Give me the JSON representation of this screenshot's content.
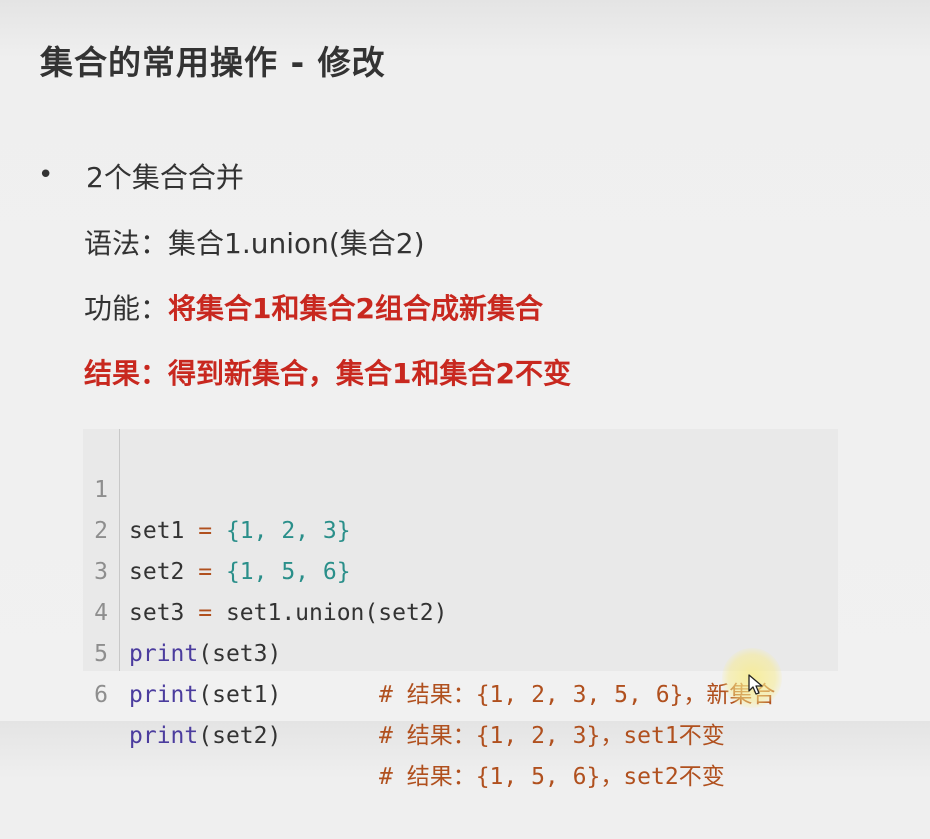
{
  "title": "集合的常用操作 - 修改",
  "bullet": {
    "symbol": "•",
    "heading": "2个集合合并",
    "syntax_label": "语法：",
    "syntax_value": "集合1.union(集合2)",
    "function_label": "功能：",
    "function_value": "将集合1和集合2组合成新集合",
    "result_text": "结果：得到新集合，集合1和集合2不变"
  },
  "code": {
    "lines": [
      {
        "num": "1",
        "a": "set1",
        "b": " = ",
        "c": "{1, 2, 3}"
      },
      {
        "num": "2",
        "a": "set2",
        "b": " = ",
        "c": "{1, 5, 6}"
      },
      {
        "num": "3",
        "a": "set3",
        "b": " = ",
        "c": "set1.union(set2)"
      },
      {
        "num": "4",
        "kw": "print",
        "arg": "(set3)",
        "comment": "# 结果：{1, 2, 3, 5, 6}，新集合"
      },
      {
        "num": "5",
        "kw": "print",
        "arg": "(set1)",
        "comment": "# 结果：{1, 2, 3}，set1不变"
      },
      {
        "num": "6",
        "kw": "print",
        "arg": "(set2)",
        "comment": "# 结果：{1, 5, 6}，set2不变"
      }
    ]
  },
  "colors": {
    "accent_red": "#c8281f",
    "code_keyword": "#4b3c9e",
    "code_comment": "#b0501e",
    "code_number": "#2a8f8a"
  },
  "icons": [
    "mouse-pointer-icon"
  ]
}
